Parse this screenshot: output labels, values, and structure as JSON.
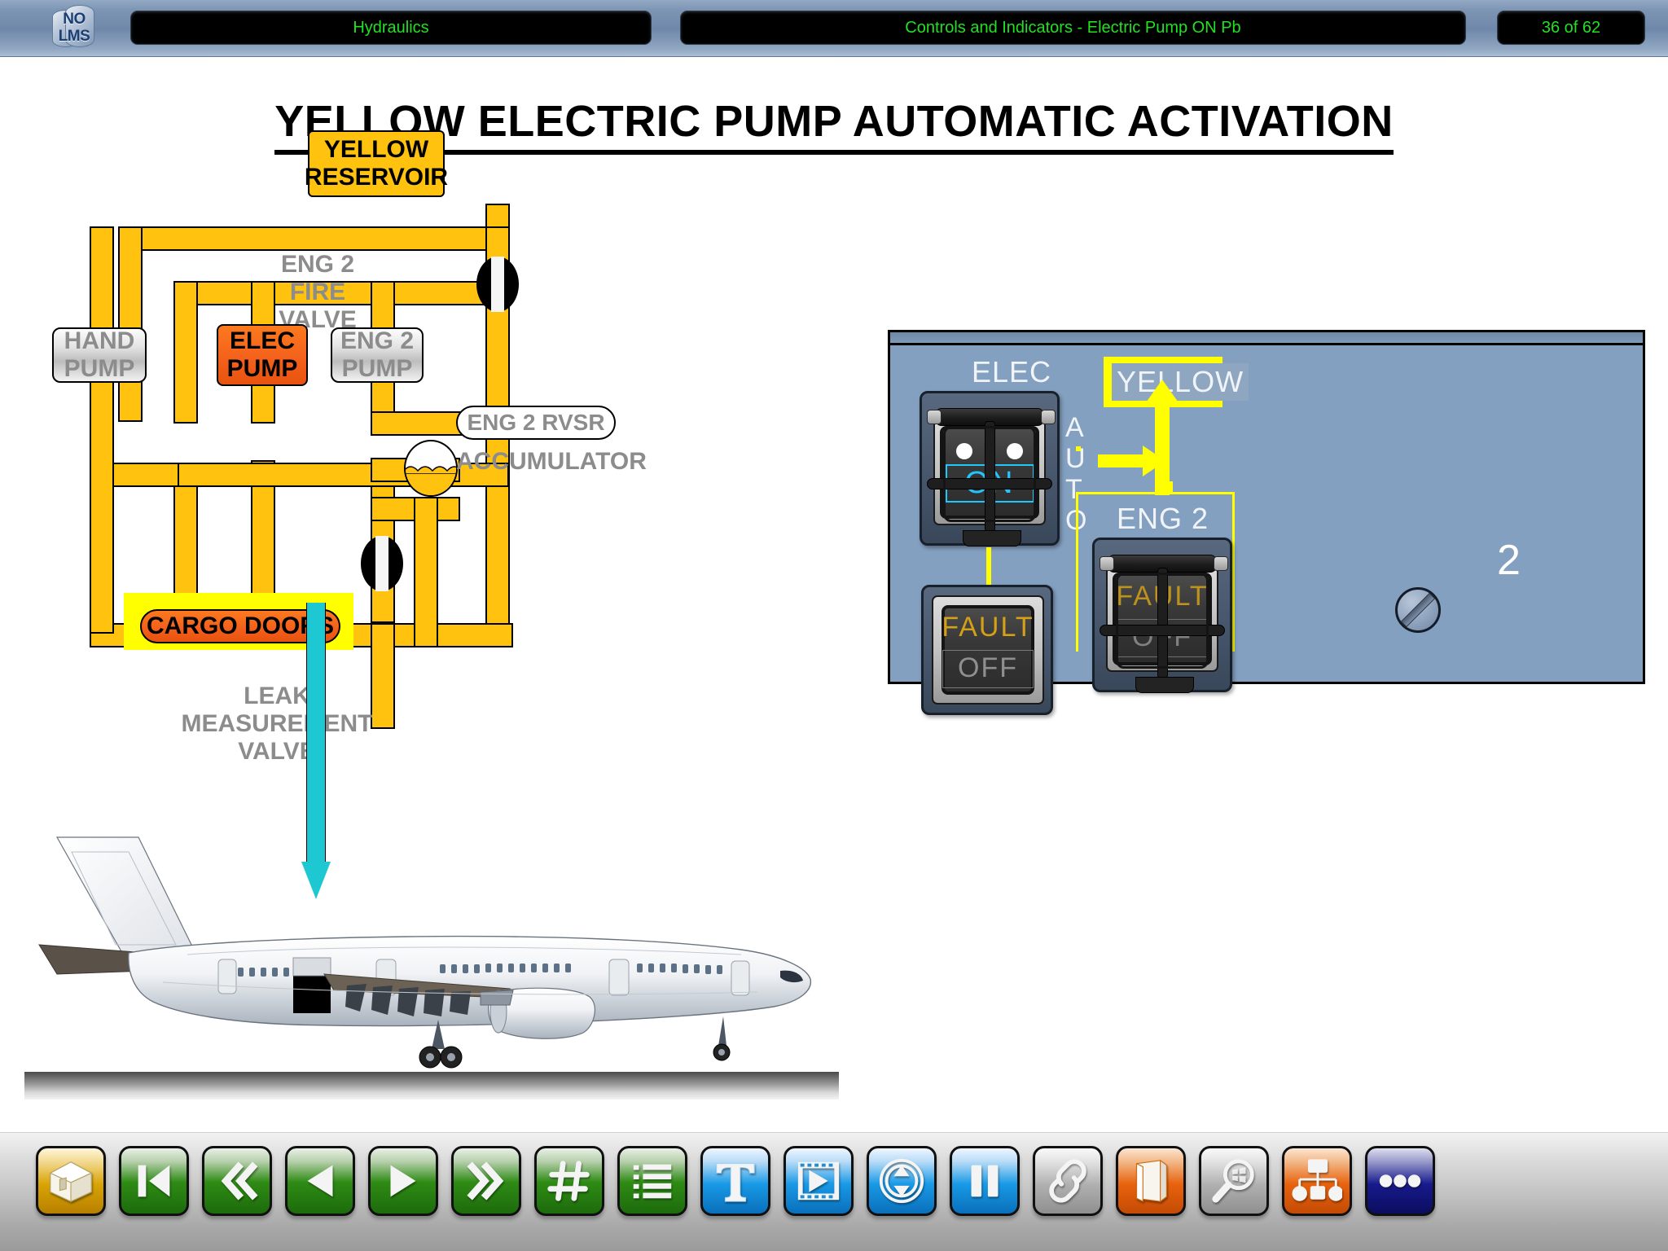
{
  "header": {
    "logo_line1": "NO",
    "logo_line2": "LMS",
    "subject": "Hydraulics",
    "topic": "Controls and Indicators - Electric Pump ON Pb",
    "page": "36 of 62"
  },
  "title": "YELLOW ELECTRIC PUMP AUTOMATIC ACTIVATION",
  "schematic": {
    "reservoir": "YELLOW\nRESERVOIR",
    "reservoir_line1": "YELLOW",
    "reservoir_line2": "RESERVOIR",
    "hand_pump_line1": "HAND",
    "hand_pump_line2": "PUMP",
    "elec_pump_line1": "ELEC",
    "elec_pump_line2": "PUMP",
    "eng2_pump_line1": "ENG 2",
    "eng2_pump_line2": "PUMP",
    "fire_valve_line1": "ENG 2",
    "fire_valve_line2": "FIRE",
    "fire_valve_line3": "VALVE",
    "eng2_rvsr": "ENG 2 RVSR",
    "accumulator": "ACCUMULATOR",
    "cargo_doors": "CARGO DOORS",
    "leak_valve_line1": "LEAK",
    "leak_valve_line2": "MEASUREMENT",
    "leak_valve_line3": "VALVE",
    "colors": {
      "pipe": "#ffc20e",
      "highlight": "#ffff00",
      "active": "#f4611c",
      "cargo_arrow": "#1ec8d2"
    }
  },
  "panel": {
    "elec_label": "ELEC",
    "yellow_label": "YELLOW",
    "auto_label": "AUTO",
    "auto_letters": [
      "A",
      "U",
      "T",
      "O"
    ],
    "eng2_label": "ENG 2",
    "panel_number": "2",
    "elec_pb": {
      "legend_top": "",
      "legend_bottom": "ON",
      "state": "ON"
    },
    "elec_fault_pb": {
      "legend_top": "FAULT",
      "legend_bottom": "OFF"
    },
    "eng2_fault_pb": {
      "legend_top": "FAULT",
      "legend_bottom": "OFF"
    },
    "colors": {
      "panel_bg": "#84a0c0",
      "fault_amber": "#d4a017",
      "on_cyan": "#1ec8ff",
      "signal_yellow": "#ffff00"
    }
  },
  "toolbar": {
    "buttons": [
      {
        "name": "home",
        "label": "Home",
        "icon": "house-icon",
        "color": "gold"
      },
      {
        "name": "first-page",
        "label": "First",
        "icon": "skip-back-icon",
        "color": "green"
      },
      {
        "name": "rewind",
        "label": "Rewind",
        "icon": "double-left-icon",
        "color": "green"
      },
      {
        "name": "previous",
        "label": "Previous",
        "icon": "play-left-icon",
        "color": "green"
      },
      {
        "name": "next",
        "label": "Next",
        "icon": "play-right-icon",
        "color": "green"
      },
      {
        "name": "forward",
        "label": "Forward",
        "icon": "double-right-icon",
        "color": "green"
      },
      {
        "name": "go-to-page",
        "label": "Go to page",
        "icon": "hash-icon",
        "color": "green"
      },
      {
        "name": "table-of-contents",
        "label": "Contents",
        "icon": "list-icon",
        "color": "green"
      },
      {
        "name": "text",
        "label": "Text",
        "icon": "text-t-icon",
        "color": "blue"
      },
      {
        "name": "video",
        "label": "Video",
        "icon": "filmstrip-icon",
        "color": "blue"
      },
      {
        "name": "zoom-vertical",
        "label": "Resize",
        "icon": "updown-circle-icon",
        "color": "blue"
      },
      {
        "name": "pause",
        "label": "Pause",
        "icon": "pause-icon",
        "color": "blue"
      },
      {
        "name": "link",
        "label": "Link",
        "icon": "chain-link-icon",
        "color": "gray"
      },
      {
        "name": "book",
        "label": "Book",
        "icon": "book-icon",
        "color": "orange"
      },
      {
        "name": "search",
        "label": "Search",
        "icon": "magnifier-icon",
        "color": "gray"
      },
      {
        "name": "sitemap",
        "label": "Sitemap",
        "icon": "sitemap-icon",
        "color": "orange"
      },
      {
        "name": "more",
        "label": "More",
        "icon": "ellipsis-icon",
        "color": "navy"
      }
    ]
  }
}
